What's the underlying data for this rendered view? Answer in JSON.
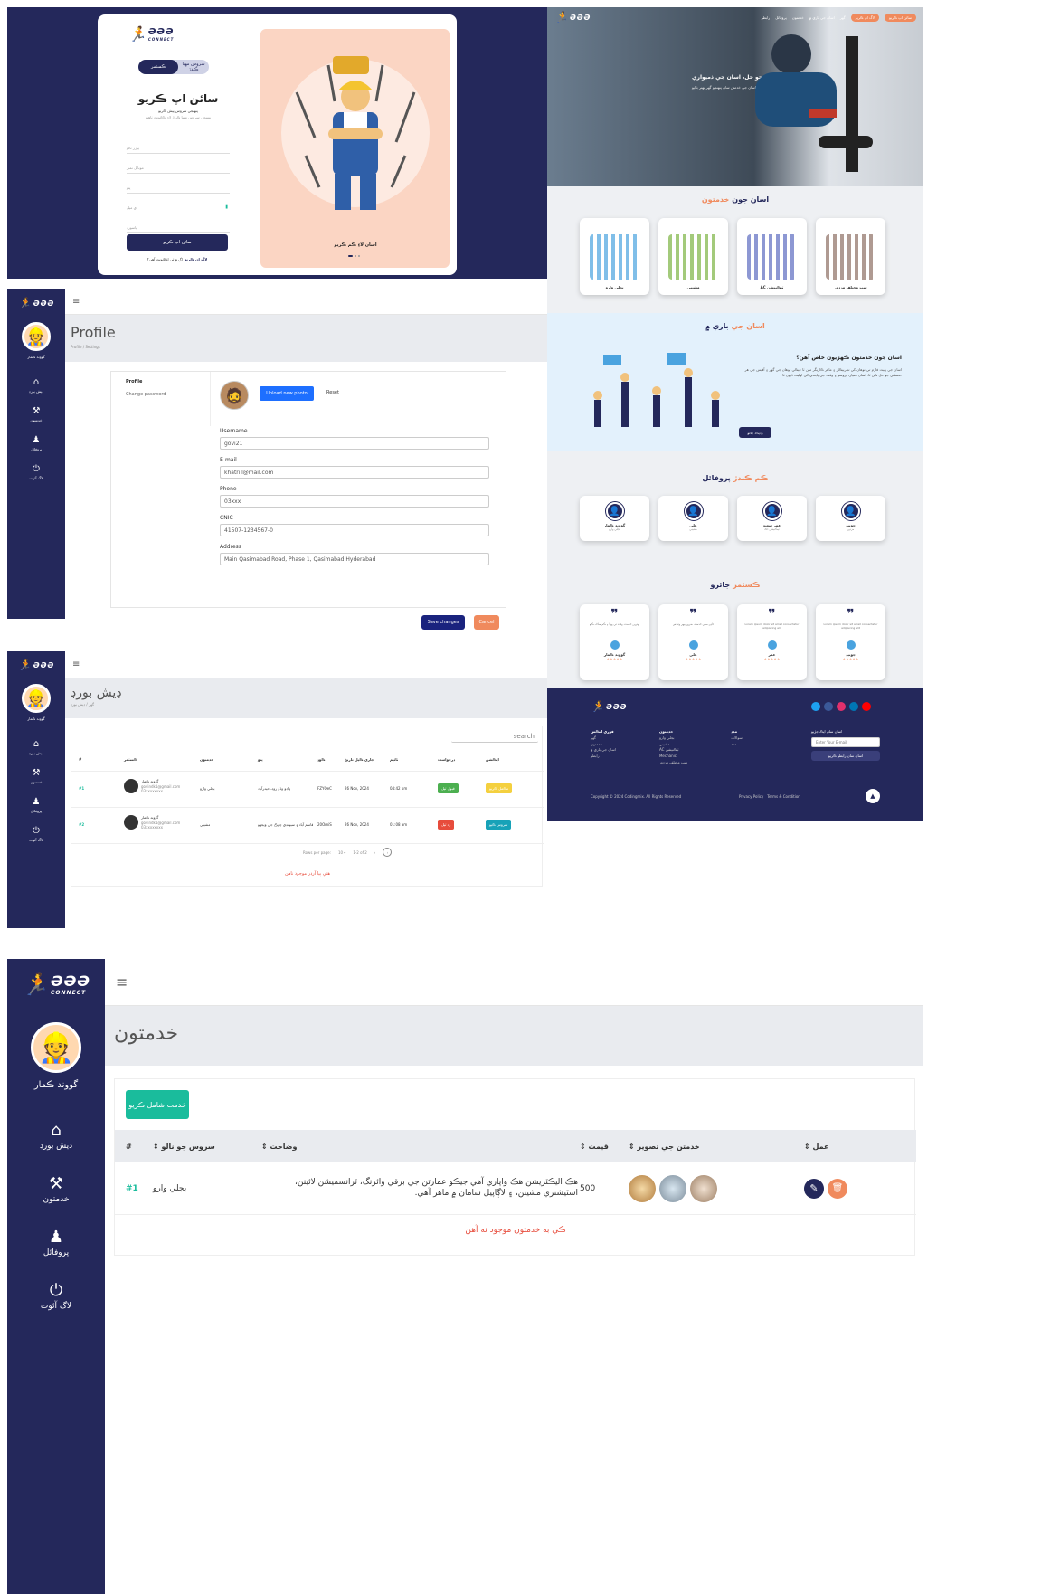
{
  "brand": {
    "logo_text": "ƏƏƏ",
    "logo_sub": "CONNECT"
  },
  "signup": {
    "toggle_left": "ڪسٽمر",
    "toggle_right": "سروس مهيا ڪندڙ",
    "title": "سائن اپ ڪريو",
    "subtitle": "پنهنجي سروس پيش ڪريو",
    "desc": "پنهنجي سروس مهيا ڪرڻ لاءِ اڪائونٽ ٺاهيو",
    "fields": [
      "يوزر نالو",
      "موبائل نمبر",
      "پتو",
      "اي ميل",
      "پاسورڊ"
    ],
    "submit": "سائن اپ ڪريو",
    "login_prompt": "اڳ ۾ ئي اڪائونٽ آهي؟",
    "login_link": "لاگ ان ڪريو",
    "promo_caption": "اسان لاءِ ڪم ڪريو"
  },
  "sidebar": {
    "user_name": "گووند ڪمار",
    "items": [
      {
        "label": "ڊيش بورڊ",
        "icon": "home-icon"
      },
      {
        "label": "خدمتون",
        "icon": "tools-icon"
      },
      {
        "label": "پروفائل",
        "icon": "user-icon"
      },
      {
        "label": "لاگ آئوٽ",
        "icon": "logout-icon"
      }
    ]
  },
  "profile": {
    "title": "Profile",
    "breadcrumb": "Profile / Settings",
    "nav": [
      "Profile",
      "Change password"
    ],
    "upload_label": "Upload new photo",
    "reset_label": "Reset",
    "fields": [
      {
        "label": "Username",
        "value": "govi21"
      },
      {
        "label": "E-mail",
        "value": "khatrill@mail.com"
      },
      {
        "label": "Phone",
        "value": "03xxx"
      },
      {
        "label": "CNIC",
        "value": "41507-1234567-0"
      },
      {
        "label": "Address",
        "value": "Main Qasimabad Road, Phase 1, Qasimabad Hyderabad"
      }
    ],
    "save_label": "Save changes",
    "cancel_label": "Cancel"
  },
  "dashboard": {
    "title": "ڊيش بورڊ",
    "breadcrumb": "گهر / ڊيش بورڊ",
    "search_placeholder": "search",
    "headers": [
      "#",
      "ڪسٽمر",
      "خدمتون",
      "پتو",
      "ڪوڊ",
      "جاري ڪيل تاريخ",
      "ٽائيم",
      "درخواست",
      "ايڪشن"
    ],
    "rows": [
      {
        "id": "#1",
        "customer": "گووند ڪمار",
        "email": "govindk1@gmail.com",
        "phone": "03xxxxxxxx",
        "service": "بجلي وارو",
        "address": "واڊو وڏو روڊ، حيدرآباد",
        "code": "FZYQeC",
        "date": "26 Nov, 2024",
        "time": "04:42 pm",
        "request": "قبول ٿيل",
        "request_color": "#4caf50",
        "action": "مڪمل ڪريو",
        "action_color": "#f4d03f"
      },
      {
        "id": "#2",
        "customer": "گووند ڪمار",
        "email": "govindk1@gmail.com",
        "phone": "03xxxxxxxx",
        "service": "مشيني",
        "address": "قاسم آباد ۽ سيونڊي چوڪ جي ويجهو",
        "code": "20OmiS",
        "date": "26 Nov, 2024",
        "time": "01:08 am",
        "request": "رد ٿيل",
        "request_color": "#e74c3c",
        "action": "سروس ڪيو",
        "action_color": "#17a2b8"
      }
    ],
    "rows_per_page": "Rows per page:",
    "rows_per_page_value": "10",
    "page_info": "1-2 of 2",
    "empty_note": "هتي ٻيا آرڊر موجود ناهن"
  },
  "services": {
    "title": "خدمتون",
    "add_button": "خدمت شامل ڪريو",
    "headers": [
      "#",
      "سروس جو نالو",
      "وضاحت",
      "قيمت",
      "خدمتن جي تصوير",
      "عمل"
    ],
    "rows": [
      {
        "id": "#1",
        "name": "بجلي وارو",
        "description": "هڪ اليڪٽريشن هڪ واپاري آهي جيڪو عمارتن جي برقي وائرنگ، ٽرانسميشن لائينن، اسٽيشنري مشينن، ۽ لاڳاپيل سامان ۾ ماهر آهي.",
        "price": "500"
      }
    ],
    "empty_note": "ڪي به خدمتون موجود نه آهن"
  },
  "landing": {
    "nav": [
      "گهر",
      "اسان جي باري ۾",
      "خدمتون",
      "پروفائل",
      "رابطو"
    ],
    "nav_btn1": "سائن اپ ڪريو",
    "nav_btn2": "لاگ ان ڪريو",
    "hero_title": "مسئلي جو حل، اسان جي ذميواري",
    "hero_sub": "اسان جي خدمتن سان پنهنجو گهر بهتر بڻايو",
    "services_title_a": "اسان جون",
    "services_title_b": "خدمتون",
    "services": [
      "بجلي وارو",
      "مشيني",
      "AC ٽيڪنيشن",
      "سڀ مختلف مزدور"
    ],
    "about_title_a": "اسان جي",
    "about_title_b": "باري ۾",
    "about_heading": "اسان جون خدمتون ڪهڙيون خاص آهن؟",
    "about_text": "اسان جي پليٽ فارم تي توهان کي تجربيڪار ۽ ماهر ڪاريگر ملن ٿا جيڪي توهان جي گهر ۽ آفيس جي هر مسئلي جو حل ڪن ٿا. اسان معيار، ڀروسو ۽ وقت جي پابندي کي اوليت ڏيون ٿا.",
    "about_btn": "وڌيڪ ڄاڻو",
    "workers_title_a": "ڪم ڪندڙ",
    "workers_title_b": "پروفائل",
    "workers": [
      {
        "name": "گووند ڪمار",
        "role": "بجلي وارو"
      },
      {
        "name": "علي",
        "role": "مشيني"
      },
      {
        "name": "عمر سعيد",
        "role": "AC ٽيڪنيشن"
      },
      {
        "name": "جونيد",
        "role": "مزدور"
      }
    ],
    "reviews_title_a": "ڪسٽمر",
    "reviews_title_b": "جائزو",
    "reviews": [
      {
        "name": "گووند ڪمار",
        "text": "بهترين خدمت، وقت تي پهتا ۽ ڪم صاف ڪيو"
      },
      {
        "name": "علي",
        "text": "ڏاڍي سٺي خدمت، ضرور ٻيهر وٺندس"
      },
      {
        "name": "عمر",
        "text": "Lorem ipsum dolor sit amet consectetur adipiscing elit"
      },
      {
        "name": "جونيد",
        "text": "Lorem ipsum dolor sit amet consectetur adipiscing elit"
      }
    ],
    "footer_cols": [
      {
        "title": "فوري لنڪس",
        "items": [
          "گهر",
          "خدمتون",
          "اسان جي باري ۾",
          "رابطو"
        ]
      },
      {
        "title": "خدمتون",
        "items": [
          "بجلي وارو",
          "مشيني",
          "AC ٽيڪنيشن",
          "Mechanic",
          "سڀ مختلف مزدور"
        ]
      },
      {
        "title": "مدد",
        "items": [
          "سوالات",
          "مدد"
        ]
      }
    ],
    "newsletter_title": "اسان سان ايڪ جڙيو",
    "email_placeholder": "Enter Your E-mail",
    "newsletter_btn": "اسان سان رابطو ڪريو",
    "copyright": "Copyright © 2024 Codingmix. All Rights Reserved",
    "policy": "Privacy Policy",
    "terms": "Terms & Condition"
  },
  "colors": {
    "navy": "#24285b",
    "orange": "#f08a5d",
    "blue": "#1e6fff",
    "teal": "#1abc9c"
  }
}
